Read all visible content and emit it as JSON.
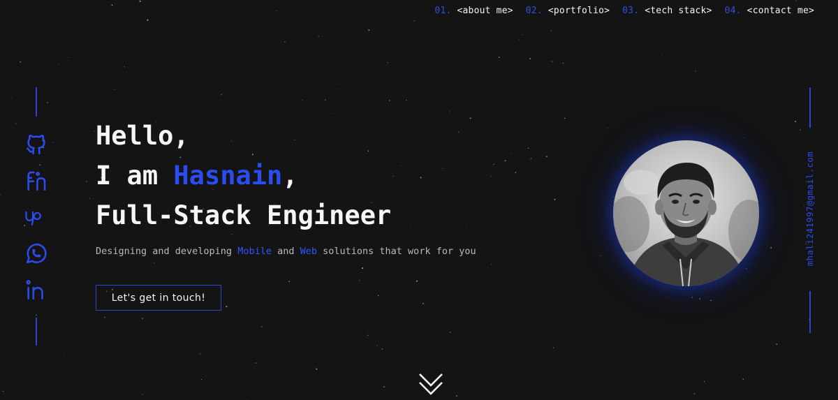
{
  "nav": {
    "items": [
      {
        "num": "01.",
        "label": "<about me>"
      },
      {
        "num": "02.",
        "label": "<portfolio>"
      },
      {
        "num": "03.",
        "label": "<tech stack>"
      },
      {
        "num": "04.",
        "label": "<contact me>"
      }
    ]
  },
  "social": {
    "icons": [
      "github-icon",
      "fiverr-icon",
      "upwork-icon",
      "whatsapp-icon",
      "linkedin-icon"
    ]
  },
  "hero": {
    "greeting": "Hello,",
    "intro_prefix": "I am ",
    "name": "Hasnain",
    "intro_suffix": ",",
    "role": "Full-Stack Engineer",
    "tagline": {
      "part1": "Designing and developing ",
      "mobile": "Mobile",
      "part2": " and ",
      "web": "Web",
      "part3": " solutions that work for you"
    },
    "cta_label": "Let's get in touch!"
  },
  "contact": {
    "email": "mhali241997@gmail.com"
  },
  "colors": {
    "background": "#141415",
    "accent": "#2a4cf0",
    "text": "#f6f6f6",
    "muted": "#b9b9bd"
  },
  "icons": {
    "scroll": "double-chevron-down-icon"
  }
}
